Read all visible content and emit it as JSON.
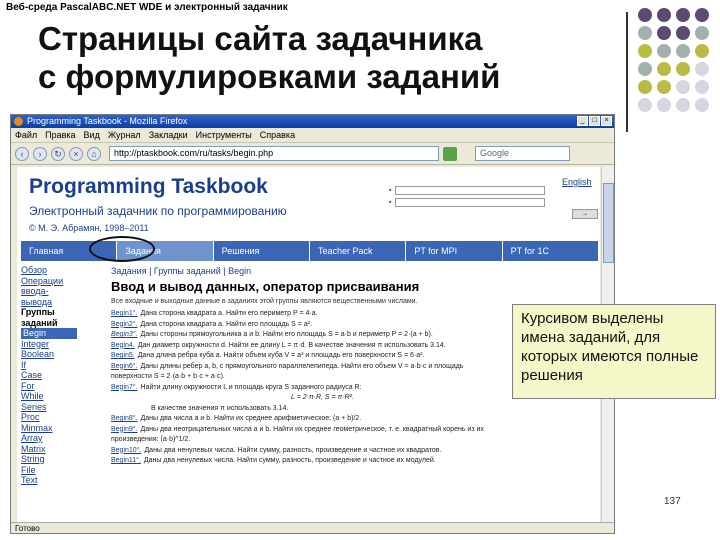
{
  "slide": {
    "caption": "Веб-среда PascalABC.NET WDE и электронный задачник",
    "title_line1": "Страницы сайта задачника",
    "title_line2": "с формулировками заданий",
    "page_number": "137",
    "dot_colors": [
      "#5c4a72",
      "#a3b0b0",
      "#b8bc45",
      "#d8d5e3"
    ]
  },
  "browser": {
    "window_title": "Programming Taskbook - Mozilla Firefox",
    "menu": [
      "Файл",
      "Правка",
      "Вид",
      "Журнал",
      "Закладки",
      "Инструменты",
      "Справка"
    ],
    "address": "http://ptaskbook.com/ru/tasks/begin.php",
    "search_placeholder": "Google",
    "status": "Готово"
  },
  "site": {
    "title": "Programming Taskbook",
    "subtitle": "Электронный задачник по программированию",
    "copyright": "© М. Э. Абрамян, 1998–2011",
    "lang": "English",
    "tabs": [
      "Главная",
      "Задания",
      "Решения",
      "Teacher Pack",
      "PT for MPI",
      "PT for 1C"
    ],
    "sidebar": [
      "Обзор",
      "Операции",
      "ввода-вывода",
      "Группы заданий",
      "Begin",
      "Integer",
      "Boolean",
      "If",
      "Case",
      "For",
      "While",
      "Series",
      "Proc",
      "Minmax",
      "Array",
      "Matrix",
      "String",
      "File",
      "Text"
    ],
    "breadcrumb": "Задания | Группы заданий | Begin",
    "content_title": "Ввод и вывод данных, оператор присваивания",
    "intro": "Все входные и выходные данные в заданиях этой группы являются вещественными числами.",
    "tasks": [
      {
        "name": "Begin1°.",
        "text": "Дана сторона квадрата a. Найти его периметр P = 4·a."
      },
      {
        "name": "Begin2°.",
        "text": "Дана сторона квадрата a. Найти его площадь S = a²."
      },
      {
        "name": "Begin3°.",
        "text": "Даны стороны прямоугольника a и b. Найти его площадь S = a·b и периметр P = 2·(a + b)."
      },
      {
        "name": "Begin4.",
        "text": "Дан диаметр окружности d. Найти ее длину L = π·d. В качестве значения π использовать 3.14."
      },
      {
        "name": "Begin5.",
        "text": "Дана длина ребра куба a. Найти объем куба V = a³ и площадь его поверхности S = 6·a²."
      },
      {
        "name": "Begin6°.",
        "text": "Даны длины ребер a, b, c прямоугольного параллелепипеда. Найти его объем V = a·b·c и площадь поверхности S = 2·(a·b + b·c + a·c)."
      },
      {
        "name": "Begin7°.",
        "text": "Найти длину окружности L и площадь круга S заданного радиуса R:"
      },
      {
        "name": "",
        "text": "L = 2·π·R,     S = π·R²."
      },
      {
        "name": "",
        "text": "В качестве значения π использовать 3.14."
      },
      {
        "name": "Begin8°.",
        "text": "Даны два числа a и b. Найти их среднее арифметическое: (a + b)/2."
      },
      {
        "name": "Begin9°.",
        "text": "Даны два неотрицательных числа a и b. Найти их среднее геометрическое, т. е. квадратный корень из их произведения: (a·b)^1/2."
      },
      {
        "name": "Begin10°.",
        "text": "Даны два ненулевых числа. Найти сумму, разность, произведение и частное их квадратов."
      },
      {
        "name": "Begin11°.",
        "text": "Даны два ненулевых числа. Найти сумму, разность, произведение и частное их модулей."
      }
    ]
  },
  "callout": "Курсивом выделены имена заданий, для которых имеются полные решения"
}
